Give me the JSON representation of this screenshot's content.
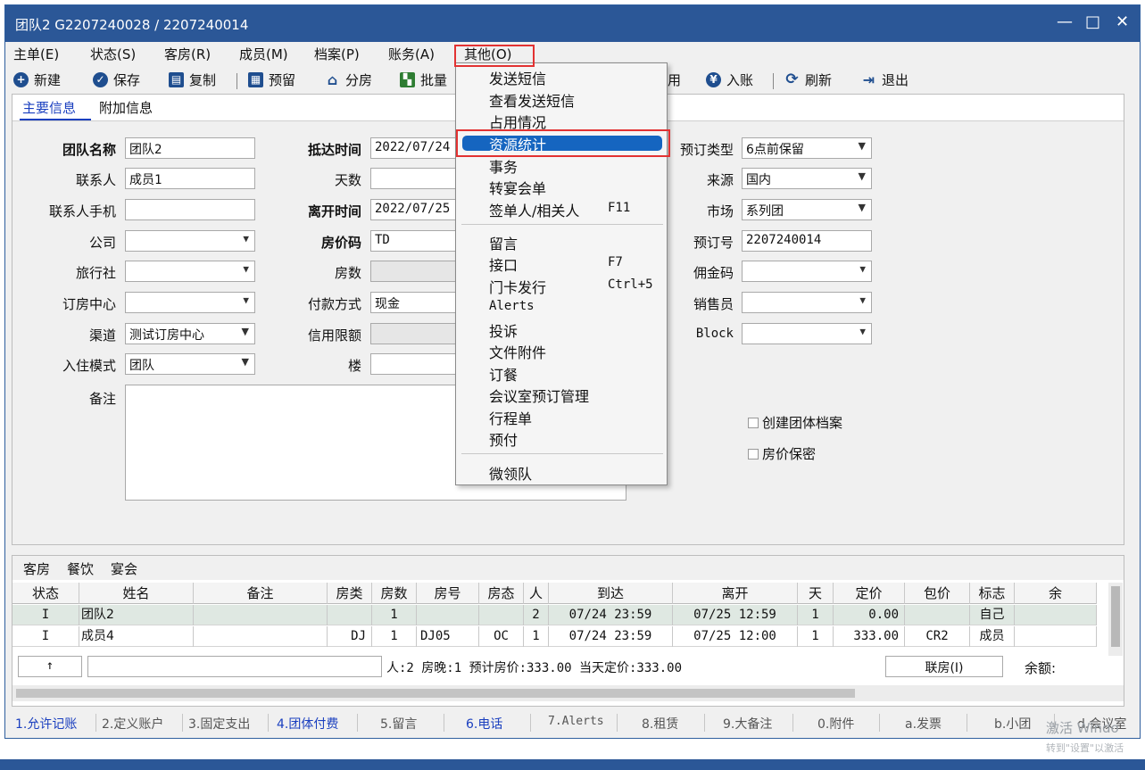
{
  "window": {
    "title": "团队2 G2207240028 / 2207240014",
    "controls": {
      "minimize": "—",
      "maximize": "□",
      "close": "✕"
    }
  },
  "menu": {
    "items": [
      "主单(E)",
      "状态(S)",
      "客房(R)",
      "成员(M)",
      "档案(P)",
      "账务(A)",
      "其他(O)"
    ]
  },
  "toolbar": {
    "new": "新建",
    "save": "保存",
    "copy": "复制",
    "reserve": "预留",
    "assign": "分房",
    "batch": "批量",
    "fee": "用",
    "post": "入账",
    "refresh": "刷新",
    "exit": "退出"
  },
  "tabs": {
    "main": "主要信息",
    "extra": "附加信息"
  },
  "form": {
    "group_name_label": "团队名称",
    "group_name": "团队2",
    "contact_label": "联系人",
    "contact": "成员1",
    "mobile_label": "联系人手机",
    "mobile": "",
    "company_label": "公司",
    "company": "",
    "agency_label": "旅行社",
    "agency": "",
    "center_label": "订房中心",
    "center": "",
    "channel_label": "渠道",
    "channel": "测试订房中心",
    "checkin_mode_label": "入住模式",
    "checkin_mode": "团队",
    "remark_label": "备注",
    "arrival_label": "抵达时间",
    "arrival": "2022/07/24",
    "days_label": "天数",
    "days": "",
    "departure_label": "离开时间",
    "departure": "2022/07/25",
    "rate_code_label": "房价码",
    "rate_code": "TD",
    "rooms_label": "房数",
    "rooms": "",
    "payment_label": "付款方式",
    "payment": "现金",
    "credit_label": "信用限额",
    "credit": "",
    "floor_label": "楼",
    "floor": "",
    "booking_type_label": "预订类型",
    "booking_type": "6点前保留",
    "source_label": "来源",
    "source": "国内",
    "market_label": "市场",
    "market": "系列团",
    "booking_no_label": "预订号",
    "booking_no": "2207240014",
    "commission_label": "佣金码",
    "commission": "",
    "sales_label": "销售员",
    "sales": "",
    "block_label": "Block",
    "block": "",
    "create_profile": "创建团体档案",
    "rate_secret": "房价保密"
  },
  "grid": {
    "tabs": [
      "客房",
      "餐饮",
      "宴会"
    ],
    "columns": [
      "状态",
      "姓名",
      "备注",
      "房类",
      "房数",
      "房号",
      "房态",
      "人",
      "到达",
      "离开",
      "天",
      "定价",
      "包价",
      "标志",
      "余"
    ],
    "rows": [
      [
        "I",
        "团队2",
        "",
        "",
        "1",
        "",
        "",
        "2",
        "07/24 23:59",
        "07/25 12:59",
        "1",
        "0.00",
        "",
        "自己",
        ""
      ],
      [
        "I",
        "成员4",
        "",
        "DJ",
        "1",
        "DJ05",
        "OC",
        "1",
        "07/24 23:59",
        "07/25 12:00",
        "1",
        "333.00",
        "CR2",
        "成员",
        ""
      ]
    ],
    "summary": {
      "arrow": "↑",
      "text": "人:2  房晚:1  预计房价:333.00  当天定价:333.00",
      "link_room": "联房(I)",
      "balance": "余额:"
    }
  },
  "status_tabs": [
    "1.允许记账",
    "2.定义账户",
    "3.固定支出",
    "4.团体付费",
    "5.留言",
    "6.电话",
    "7.Alerts",
    "8.租赁",
    "9.大备注",
    "0.附件",
    "a.发票",
    "b.小团",
    "d.会议室"
  ],
  "dropdown": {
    "items": [
      {
        "label": "发送短信"
      },
      {
        "label": "查看发送短信"
      },
      {
        "label": "占用情况"
      },
      {
        "label": "资源统计"
      },
      {
        "label": "事务"
      },
      {
        "label": "转宴会单"
      },
      {
        "label": "签单人/相关人",
        "shortcut": "F11"
      },
      {
        "label": "留言"
      },
      {
        "label": "接口",
        "shortcut": "F7"
      },
      {
        "label": "门卡发行",
        "shortcut": "Ctrl+5"
      },
      {
        "label": "Alerts"
      },
      {
        "label": "投诉"
      },
      {
        "label": "文件附件"
      },
      {
        "label": "订餐"
      },
      {
        "label": "会议室预订管理"
      },
      {
        "label": "行程单"
      },
      {
        "label": "预付"
      },
      {
        "label": "微领队"
      }
    ]
  },
  "watermark": {
    "line1": "激活 Windo",
    "line2": "转到\"设置\"以激活"
  },
  "colors": {
    "titlebar": "#2b5797",
    "highlight": "#1565c0",
    "annotation": "#e23232"
  }
}
